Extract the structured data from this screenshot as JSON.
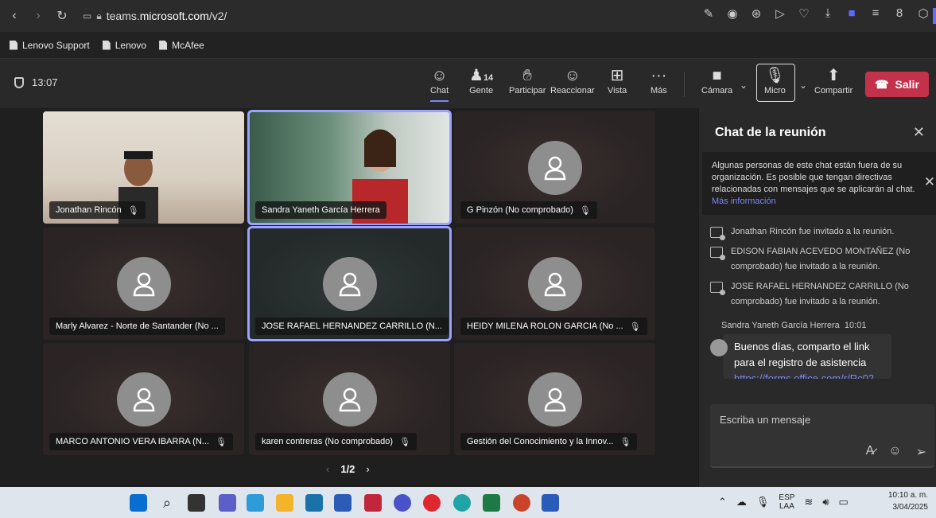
{
  "browser": {
    "url_prefix": "teams.",
    "url_domain": "microsoft.com",
    "url_path": "/v2/"
  },
  "bookmarks": [
    {
      "label": "Lenovo Support"
    },
    {
      "label": "Lenovo"
    },
    {
      "label": "McAfee"
    }
  ],
  "meeting": {
    "elapsed": "13:07",
    "toolbar": {
      "chat": "Chat",
      "people": "Gente",
      "people_count": "14",
      "participate": "Participar",
      "react": "Reaccionar",
      "view": "Vista",
      "more": "Más",
      "camera": "Cámara",
      "mic": "Micro",
      "share": "Compartir",
      "leave": "Salir"
    }
  },
  "participants": [
    {
      "name": "Jonathan Rincón",
      "muted": true
    },
    {
      "name": "Sandra Yaneth García Herrera",
      "muted": false
    },
    {
      "name": "G Pinzón (No comprobado)",
      "muted": true
    },
    {
      "name": "Marly Alvarez - Norte de Santander (No ...",
      "muted": false
    },
    {
      "name": "JOSE RAFAEL HERNANDEZ CARRILLO (N...",
      "muted": false
    },
    {
      "name": "HEIDY MILENA ROLON GARCIA (No ...",
      "muted": true
    },
    {
      "name": "MARCO ANTONIO VERA IBARRA (N...",
      "muted": true
    },
    {
      "name": "karen contreras (No comprobado)",
      "muted": true
    },
    {
      "name": "Gestión del Conocimiento y la Innov...",
      "muted": true
    }
  ],
  "pager": {
    "label": "1/2"
  },
  "chat": {
    "title": "Chat de la reunión",
    "notice": "Algunas personas de este chat están fuera de su organización. Es posible que tengan directivas relacionadas con mensajes que se aplicarán al chat.",
    "notice_link": "Más información",
    "events": [
      "Jonathan Rincón fue invitado a la reunión.",
      "EDISON FABIAN ACEVEDO MONTAÑEZ (No comprobado) fue invitado a la reunión.",
      "JOSE RAFAEL HERNANDEZ CARRILLO (No comprobado) fue invitado a la reunión."
    ],
    "message": {
      "author": "Sandra Yaneth García Herrera",
      "time": "10:01",
      "text": "Buenos días, comparto el link para el registro de asistencia",
      "link": "https://forms.office.com/r/Rc02"
    },
    "compose_placeholder": "Escriba un mensaje"
  },
  "taskbar": {
    "lang_top": "ESP",
    "lang_bottom": "LAA",
    "time": "10:10 a. m.",
    "date": "3/04/2025"
  }
}
